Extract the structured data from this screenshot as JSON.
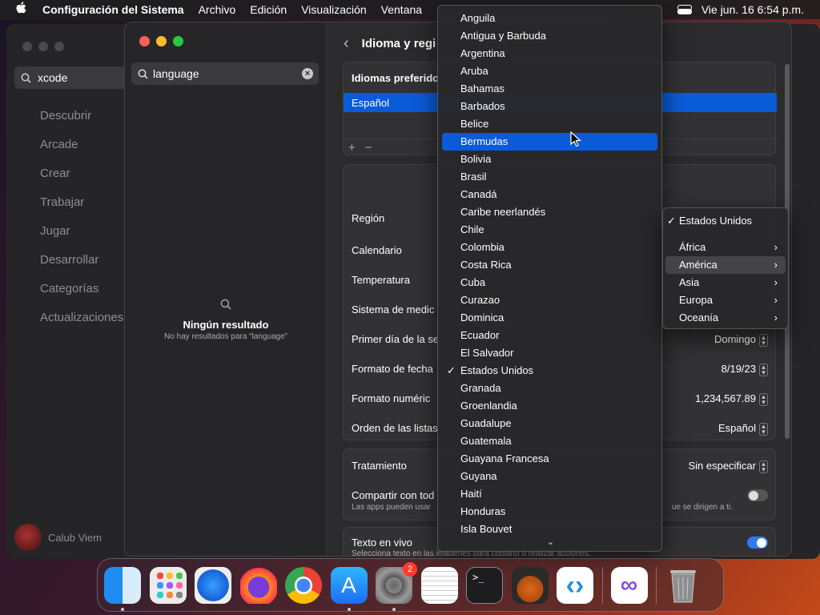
{
  "menubar": {
    "app_name": "Configuración del Sistema",
    "items": [
      "Archivo",
      "Edición",
      "Visualización",
      "Ventana"
    ],
    "clock": "Vie jun. 16  6:54 p.m."
  },
  "appstore": {
    "search_value": "xcode",
    "nav": [
      "Descubrir",
      "Arcade",
      "Crear",
      "Trabajar",
      "Jugar",
      "Desarrollar",
      "Categorías",
      "Actualizaciones"
    ],
    "user": "Calub Viem"
  },
  "settings": {
    "search_value": "language",
    "no_results_title": "Ningún resultado",
    "no_results_sub": "No hay resultados para “language”",
    "header_title": "Idioma y regi",
    "preferred_header": "Idiomas preferido",
    "preferred_selected": "Español",
    "rows": {
      "region": "Región",
      "calendar": "Calendario",
      "temperature": "Temperatura",
      "measure": "Sistema de medic",
      "first_day": "Primer día de la se",
      "first_day_value": "Domingo",
      "date_format": "Formato de fecha",
      "date_format_value": "8/19/23",
      "number_format": "Formato numéric",
      "number_format_value": "1,234,567.89",
      "list_order": "Orden de las listas",
      "list_order_value": "Español"
    },
    "treatment": "Tratamiento",
    "treatment_value": "Sin especificar",
    "share": "Compartir con tod",
    "share_sub_left": "Las apps pueden usar",
    "share_sub_right": "ue se dirigen a ti.",
    "live_text": "Texto en vivo",
    "live_text_sub": "Selecciona texto en las imágenes para copiarlo o realizar acciones."
  },
  "country_menu": {
    "items": [
      "Anguila",
      "Antigua y Barbuda",
      "Argentina",
      "Aruba",
      "Bahamas",
      "Barbados",
      "Belice",
      "Bermudas",
      "Bolivia",
      "Brasil",
      "Canadá",
      "Caribe neerlandés",
      "Chile",
      "Colombia",
      "Costa Rica",
      "Cuba",
      "Curazao",
      "Dominica",
      "Ecuador",
      "El Salvador",
      "Estados Unidos",
      "Granada",
      "Groenlandia",
      "Guadalupe",
      "Guatemala",
      "Guayana Francesa",
      "Guyana",
      "Haití",
      "Honduras",
      "Isla Bouvet"
    ],
    "highlighted": "Bermudas",
    "checked": "Estados Unidos"
  },
  "region_menu": {
    "current": "Estados Unidos",
    "items": [
      "África",
      "América",
      "Asia",
      "Europa",
      "Oceanía"
    ],
    "highlighted": "América"
  },
  "dock": {
    "badge_settings": "2",
    "apps": [
      "finder-icon",
      "launchpad-icon",
      "safari-icon",
      "firefox-icon",
      "chrome-icon",
      "app-store-icon",
      "system-settings-icon",
      "textedit-icon",
      "terminal-icon",
      "garageband-icon",
      "vscode-icon",
      "visual-studio-icon",
      "trash-icon"
    ]
  },
  "colors": {
    "accent": "#0a5bd8",
    "close": "#fe5f57",
    "minimize": "#febc2e",
    "zoom": "#28c840"
  }
}
